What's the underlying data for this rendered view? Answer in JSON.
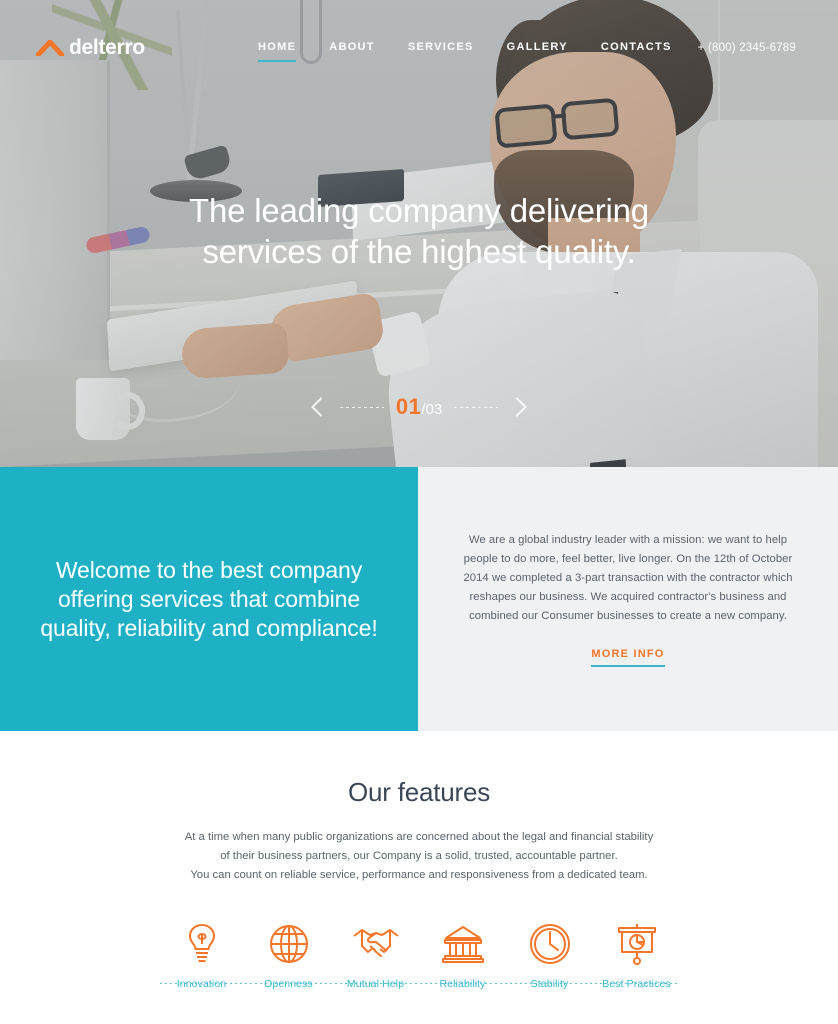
{
  "header": {
    "logo_text": "delterro",
    "logo_icon": "chevron-up-mark",
    "phone": "+ (800) 2345-6789",
    "nav": [
      {
        "label": "HOME",
        "active": true
      },
      {
        "label": "ABOUT",
        "active": false
      },
      {
        "label": "SERVICES",
        "active": false
      },
      {
        "label": "GALLERY",
        "active": false
      },
      {
        "label": "CONTACTS",
        "active": false
      }
    ]
  },
  "hero": {
    "heading": "The leading company delivering services of the highest quality.",
    "slider": {
      "current": "01",
      "total": "/03",
      "prev_icon": "chevron-left-icon",
      "next_icon": "chevron-right-icon"
    }
  },
  "welcome": {
    "heading": "Welcome to the best company offering services that combine quality, reliability and compliance!",
    "paragraph": "We are a global industry leader with a mission: we want to help people to do more, feel better, live longer. On the 12th of October 2014 we completed a 3-part transaction with the contractor which reshapes our business. We acquired contractor's business and combined our Consumer businesses to create a new company.",
    "more_info_label": "MORE INFO"
  },
  "features": {
    "title": "Our features",
    "description_line1": "At a time when many public organizations are concerned about the legal and financial stability",
    "description_line2": "of their business partners, our Company is a solid, trusted, accountable partner.",
    "description_line3": "You can count on reliable service, performance and responsiveness from a dedicated team.",
    "items": [
      {
        "label": "Innovation",
        "icon": "lightbulb-icon"
      },
      {
        "label": "Openness",
        "icon": "globe-icon"
      },
      {
        "label": "Mutual Help",
        "icon": "handshake-icon"
      },
      {
        "label": "Reliability",
        "icon": "bank-building-icon"
      },
      {
        "label": "Stability",
        "icon": "clock-icon"
      },
      {
        "label": "Best Practices",
        "icon": "presentation-chart-icon"
      }
    ]
  },
  "colors": {
    "teal": "#1eb1c6",
    "teal_accent": "#3ab7cd",
    "orange": "#f4762a",
    "panel_gray": "#f0f1f2",
    "text_dark": "#3b4754",
    "text_body": "#5b636d"
  }
}
